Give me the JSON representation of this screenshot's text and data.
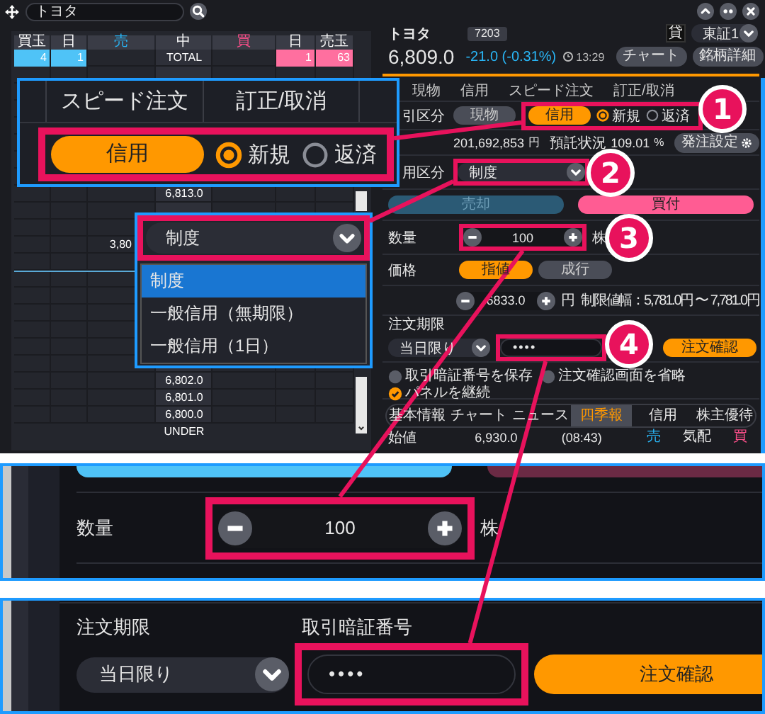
{
  "top_bar": {
    "search_value": "トヨタ"
  },
  "order_book": {
    "columns": [
      {
        "label": "買玉",
        "color": "#ffffff"
      },
      {
        "label": "日",
        "color": "#ffffff"
      },
      {
        "label": "売",
        "color": "#29b6f6"
      },
      {
        "label": "中",
        "color": "#ffffff"
      },
      {
        "label": "買",
        "color": "#ff4f8b"
      },
      {
        "label": "日",
        "color": "#ffffff"
      },
      {
        "label": "売玉",
        "color": "#ffffff"
      }
    ],
    "total": [
      {
        "kind": "ask",
        "text": "4"
      },
      {
        "kind": "ask",
        "text": "1"
      },
      {
        "kind": "blank"
      },
      {
        "kind": "label",
        "text": "TOTAL"
      },
      {
        "kind": "blank"
      },
      {
        "kind": "bid",
        "text": "1"
      },
      {
        "kind": "bid",
        "text": "63"
      }
    ],
    "rows": [
      {
        "kind": "blank"
      },
      {
        "kind": "blank"
      },
      {
        "kind": "blank"
      },
      {
        "kind": "blank"
      },
      {
        "kind": "blank"
      },
      {
        "kind": "blank"
      },
      {
        "kind": "blank"
      },
      {
        "kind": "price",
        "price": "6,813.0"
      },
      {
        "kind": "blank"
      },
      {
        "kind": "blank"
      },
      {
        "kind": "sell",
        "sell": "3,80"
      },
      {
        "kind": "blank"
      },
      {
        "kind": "mid"
      },
      {
        "kind": "blank"
      },
      {
        "kind": "blank"
      },
      {
        "kind": "blank"
      },
      {
        "kind": "blank"
      },
      {
        "kind": "blank"
      },
      {
        "kind": "price",
        "price": "6,802.0"
      },
      {
        "kind": "price",
        "price": "6,801.0"
      },
      {
        "kind": "price",
        "price": "6,800.0"
      },
      {
        "kind": "under",
        "price": "UNDER"
      }
    ]
  },
  "stock": {
    "name": "トヨタ",
    "code": "7203",
    "lend_badge": "貸",
    "market": "東証1",
    "price": "6,809.0",
    "change": "-21.0 (-0.31%)",
    "time": "13:29",
    "buttons": [
      "チャート",
      "銘柄詳細"
    ]
  },
  "order_tabs": [
    "現物",
    "信用",
    "スピード注文",
    "訂正/取消"
  ],
  "trade": {
    "label": "引区分",
    "options": [
      {
        "label": "現物",
        "selected": false
      },
      {
        "label": "信用",
        "selected": true
      }
    ],
    "radios": [
      {
        "label": "新規",
        "selected": true
      },
      {
        "label": "返済",
        "selected": false
      }
    ]
  },
  "margin": {
    "amount": "201,692,853",
    "amount_unit": "円",
    "deposit_label": "預託状況",
    "deposit_value": "109.01",
    "deposit_unit": "%",
    "settings_button": "発注設定"
  },
  "credit": {
    "label": "用区分",
    "value": "制度"
  },
  "sides": [
    {
      "label": "売却",
      "selected": false,
      "color": "#2b5a75"
    },
    {
      "label": "買付",
      "selected": true,
      "color": "#ff5c93"
    }
  ],
  "quantity": {
    "label": "数量",
    "value": "100",
    "unit": "株"
  },
  "price": {
    "label": "価格",
    "types": [
      {
        "label": "指値",
        "selected": true
      },
      {
        "label": "成行",
        "selected": false
      }
    ],
    "value": "6833.0",
    "unit": "円",
    "limit_text": "制限値幅：5,781.0円 〜 7,781.0円"
  },
  "expiry": {
    "label": "注文期限",
    "value": "当日限り"
  },
  "pin": {
    "value": "••••"
  },
  "confirm_button": "注文確認",
  "options": [
    {
      "label": "取引暗証番号を保存",
      "checked": false
    },
    {
      "label": "注文確認画面を省略",
      "checked": false
    },
    {
      "label": "パネルを継続",
      "checked": true
    }
  ],
  "info_tabs": [
    {
      "label": "基本情報",
      "selected": false
    },
    {
      "label": "チャート",
      "selected": false
    },
    {
      "label": "ニュース",
      "selected": false
    },
    {
      "label": "四季報",
      "selected": true
    },
    {
      "label": "信用",
      "selected": false
    },
    {
      "label": "株主優待",
      "selected": false
    }
  ],
  "quote": {
    "label": "始値",
    "value": "6,930.0",
    "time": "(08:43)",
    "columns": [
      {
        "label": "売",
        "color": "#29b6f6"
      },
      {
        "label": "気配",
        "color": "#e6e6e6"
      },
      {
        "label": "買",
        "color": "#ff4f8b"
      }
    ]
  },
  "callout_speed": {
    "tabs": [
      "スピード注文",
      "訂正/取消"
    ],
    "button": "信用",
    "radios": [
      {
        "label": "新規",
        "selected": true
      },
      {
        "label": "返済",
        "selected": false
      }
    ]
  },
  "callout_credit": {
    "value": "制度",
    "options": [
      {
        "label": "制度",
        "selected": true
      },
      {
        "label": "一般信用（無期限）",
        "selected": false
      },
      {
        "label": "一般信用（1日）",
        "selected": false
      }
    ]
  },
  "markers": [
    "1",
    "2",
    "3",
    "4"
  ],
  "detail_quantity": {
    "label": "数量",
    "value": "100",
    "unit": "株"
  },
  "detail_order": {
    "expiry_label": "注文期限",
    "expiry_value": "当日限り",
    "pin_label": "取引暗証番号",
    "pin_value": "••••",
    "confirm_button": "注文確認"
  }
}
